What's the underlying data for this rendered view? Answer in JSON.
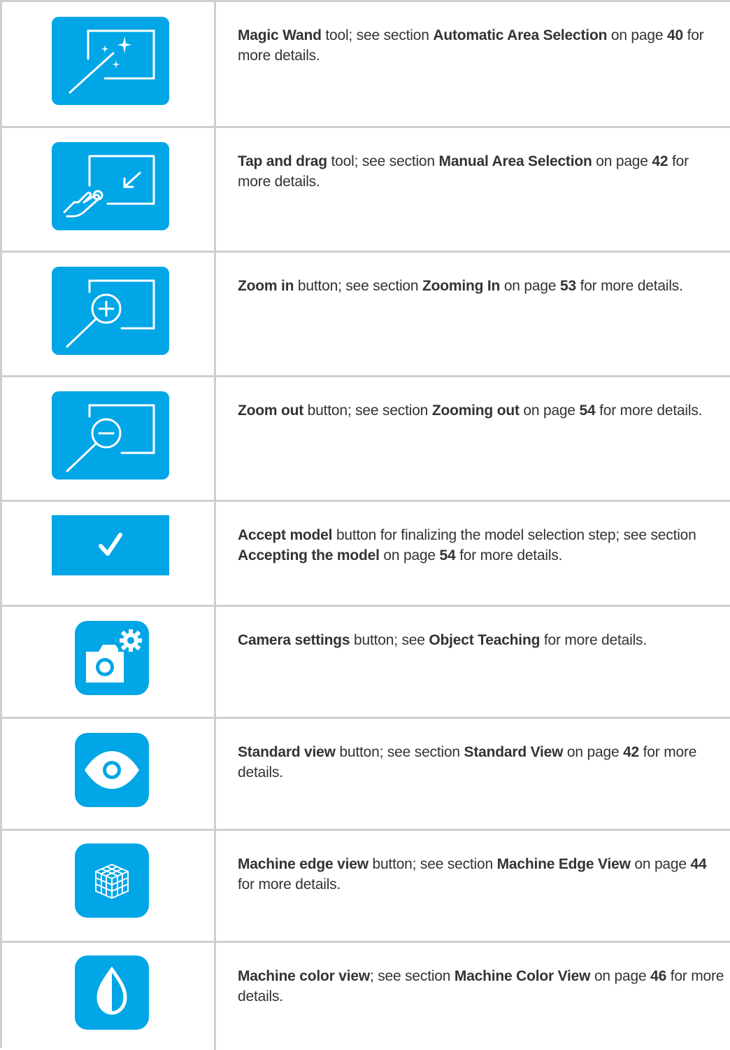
{
  "rows": [
    {
      "icon": "magic-wand-icon",
      "parts": [
        {
          "t": "Magic Wand",
          "b": true
        },
        {
          "t": " tool; see section ",
          "b": false
        },
        {
          "t": "Automatic Area Selection",
          "b": true
        },
        {
          "t": " on page ",
          "b": false
        },
        {
          "t": "40",
          "b": true
        },
        {
          "t": " for more details.",
          "b": false
        }
      ]
    },
    {
      "icon": "tap-and-drag-icon",
      "parts": [
        {
          "t": "Tap and drag",
          "b": true
        },
        {
          "t": " tool; see section ",
          "b": false
        },
        {
          "t": "Manual Area Selection",
          "b": true
        },
        {
          "t": " on page ",
          "b": false
        },
        {
          "t": "42",
          "b": true
        },
        {
          "t": " for more details.",
          "b": false
        }
      ]
    },
    {
      "icon": "zoom-in-icon",
      "parts": [
        {
          "t": "Zoom in",
          "b": true
        },
        {
          "t": " button; see section ",
          "b": false
        },
        {
          "t": "Zooming In",
          "b": true
        },
        {
          "t": " on page ",
          "b": false
        },
        {
          "t": "53",
          "b": true
        },
        {
          "t": " for more details.",
          "b": false
        }
      ]
    },
    {
      "icon": "zoom-out-icon",
      "parts": [
        {
          "t": "Zoom out",
          "b": true
        },
        {
          "t": " button; see section ",
          "b": false
        },
        {
          "t": "Zooming out",
          "b": true
        },
        {
          "t": " on page ",
          "b": false
        },
        {
          "t": "54",
          "b": true
        },
        {
          "t": " for more details.",
          "b": false
        }
      ]
    },
    {
      "icon": "checkmark-icon",
      "parts": [
        {
          "t": "Accept model",
          "b": true
        },
        {
          "t": " button for finalizing the model selection step; see section ",
          "b": false
        },
        {
          "t": "Accepting the model",
          "b": true
        },
        {
          "t": " on page ",
          "b": false
        },
        {
          "t": "54",
          "b": true
        },
        {
          "t": " for more details.",
          "b": false
        }
      ]
    },
    {
      "icon": "camera-settings-icon",
      "parts": [
        {
          "t": "Camera settings",
          "b": true
        },
        {
          "t": " button; see ",
          "b": false
        },
        {
          "t": "Object Teaching",
          "b": true
        },
        {
          "t": " for more details.",
          "b": false
        }
      ]
    },
    {
      "icon": "eye-icon",
      "parts": [
        {
          "t": "Standard view",
          "b": true
        },
        {
          "t": " button; see section ",
          "b": false
        },
        {
          "t": "Standard View",
          "b": true
        },
        {
          "t": " on page ",
          "b": false
        },
        {
          "t": "42",
          "b": true
        },
        {
          "t": " for more details.",
          "b": false
        }
      ]
    },
    {
      "icon": "cube-grid-icon",
      "parts": [
        {
          "t": "Machine edge view",
          "b": true
        },
        {
          "t": " button; see section ",
          "b": false
        },
        {
          "t": "Machine Edge View",
          "b": true
        },
        {
          "t": " on page ",
          "b": false
        },
        {
          "t": "44",
          "b": true
        },
        {
          "t": " for more details.",
          "b": false
        }
      ]
    },
    {
      "icon": "color-drop-icon",
      "parts": [
        {
          "t": "Machine color view",
          "b": true
        },
        {
          "t": "; see section ",
          "b": false
        },
        {
          "t": "Machine Color View",
          "b": true
        },
        {
          "t": " on page ",
          "b": false
        },
        {
          "t": "46",
          "b": true
        },
        {
          "t": " for more details.",
          "b": false
        }
      ]
    }
  ],
  "colors": {
    "tile": "#00a6e6",
    "rule": "#cfcfcf",
    "text": "#333333"
  }
}
